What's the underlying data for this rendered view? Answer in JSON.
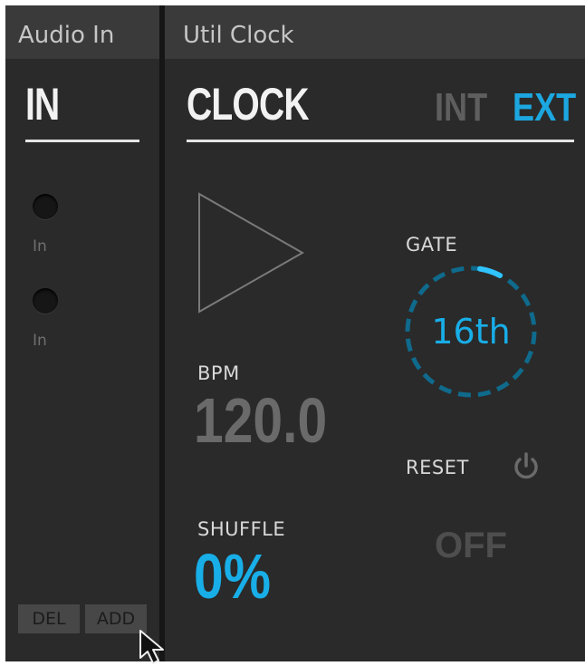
{
  "tabs": [
    {
      "label": "Audio In"
    },
    {
      "label": "Util Clock"
    }
  ],
  "audio_in": {
    "title": "IN",
    "jacks": [
      {
        "label": "In"
      },
      {
        "label": "In"
      }
    ],
    "del_label": "DEL",
    "add_label": "ADD"
  },
  "clock": {
    "title": "CLOCK",
    "mode_int": "INT",
    "mode_ext": "EXT",
    "selected_mode": "EXT",
    "bpm_label": "BPM",
    "bpm_value": "120.0",
    "shuffle_label": "SHUFFLE",
    "shuffle_value": "0%",
    "gate_label": "GATE",
    "gate_value": "16th",
    "reset_label": "RESET",
    "reset_value": "OFF"
  },
  "icons": {
    "play": "play-icon",
    "power": "power-icon",
    "cursor": "mouse-cursor-icon"
  },
  "colors": {
    "accent": "#18aee8",
    "background": "#2a2a2a",
    "inactive": "#5e5e5e"
  }
}
